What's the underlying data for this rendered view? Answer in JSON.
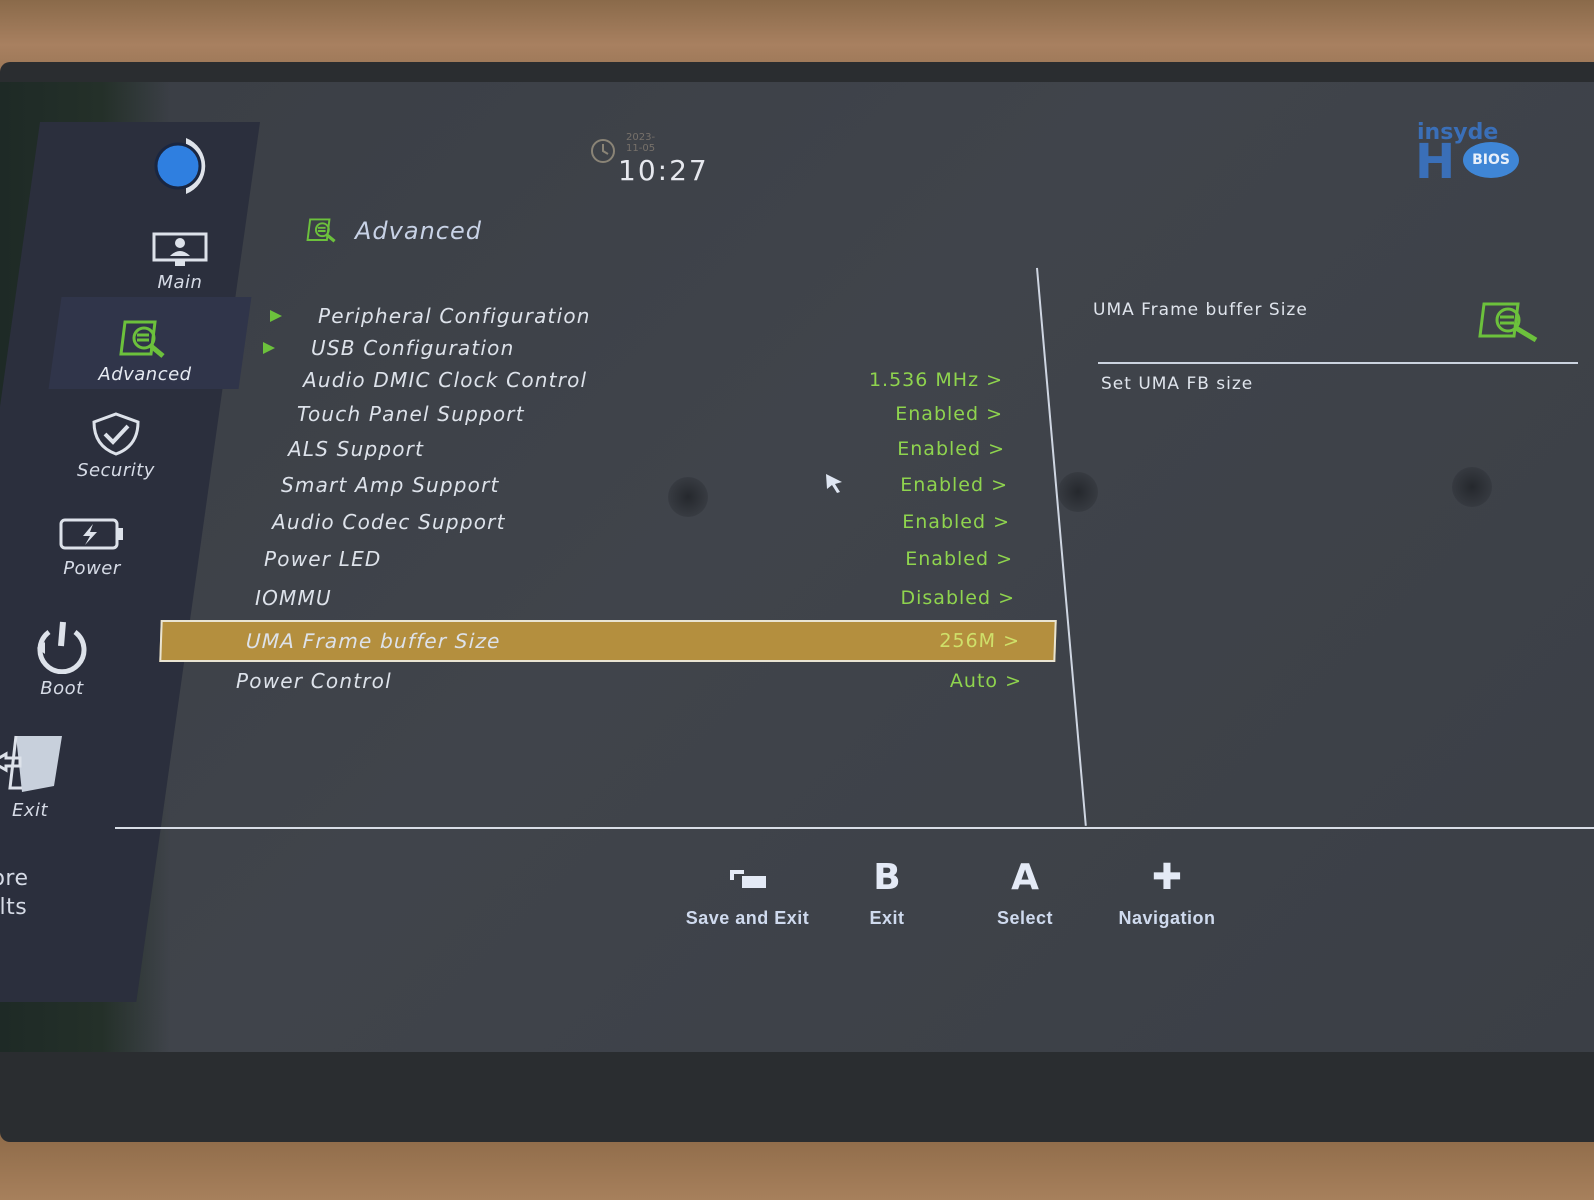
{
  "clock": {
    "time": "10:27",
    "date": "2023-11-05"
  },
  "brand": {
    "line1": "insyde",
    "line2": "H",
    "badge": "BIOS"
  },
  "sidebar": {
    "items": [
      {
        "label": "Main",
        "icon": "monitor-user-icon",
        "active": false
      },
      {
        "label": "Advanced",
        "icon": "advanced-search-doc-icon",
        "active": true
      },
      {
        "label": "Security",
        "icon": "shield-check-icon",
        "active": false
      },
      {
        "label": "Power",
        "icon": "battery-bolt-icon",
        "active": false
      },
      {
        "label": "Boot",
        "icon": "power-restart-icon",
        "active": false
      },
      {
        "label": "Exit",
        "icon": "exit-door-icon",
        "active": false
      },
      {
        "label": "ore",
        "icon": "",
        "active": false
      },
      {
        "label": "ilts",
        "icon": "",
        "active": false
      }
    ]
  },
  "page": {
    "title": "Advanced"
  },
  "menu": {
    "items": [
      {
        "name": "Peripheral Configuration",
        "value": "",
        "submenu": true
      },
      {
        "name": "USB Configuration",
        "value": "",
        "submenu": true
      },
      {
        "name": "Audio DMIC Clock Control",
        "value": "1.536 MHz >",
        "submenu": false
      },
      {
        "name": "Touch Panel Support",
        "value": "Enabled >",
        "submenu": false
      },
      {
        "name": "ALS Support",
        "value": "Enabled >",
        "submenu": false
      },
      {
        "name": "Smart Amp Support",
        "value": "Enabled >",
        "submenu": false
      },
      {
        "name": "Audio Codec Support",
        "value": "Enabled >",
        "submenu": false
      },
      {
        "name": "Power LED",
        "value": "Enabled >",
        "submenu": false
      },
      {
        "name": "IOMMU",
        "value": "Disabled >",
        "submenu": false
      },
      {
        "name": "UMA Frame buffer Size",
        "value": "256M >",
        "submenu": false,
        "selected": true
      },
      {
        "name": "Power Control",
        "value": "Auto >",
        "submenu": false
      }
    ]
  },
  "help": {
    "title": "UMA Frame buffer Size",
    "description": "Set UMA FB size"
  },
  "footer": {
    "buttons": [
      {
        "key": "▭",
        "label": "Save and Exit",
        "icon": "save-exit-icon"
      },
      {
        "key": "B",
        "label": "Exit",
        "icon": "b-button-icon"
      },
      {
        "key": "A",
        "label": "Select",
        "icon": "a-button-icon"
      },
      {
        "key": "✚",
        "label": "Navigation",
        "icon": "dpad-icon"
      }
    ]
  },
  "colors": {
    "value_green": "#8fd44e",
    "selection_gold": "#b48f3e",
    "icon_green": "#6cc13c",
    "text_light": "#dde2ea"
  }
}
